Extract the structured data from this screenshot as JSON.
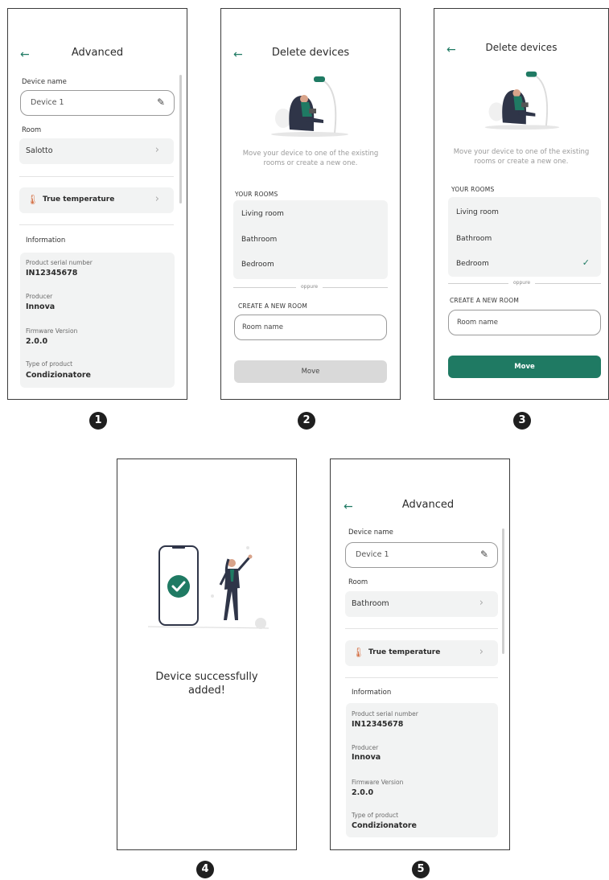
{
  "screens": {
    "s1": {
      "title": "Advanced",
      "device_name_label": "Device name",
      "device_name_value": "Device 1",
      "room_label": "Room",
      "room_value": "Salotto",
      "true_temperature": "True temperature",
      "information_label": "Information",
      "serial_label": "Product serial number",
      "serial_value": "IN12345678",
      "producer_label": "Producer",
      "producer_value": "Innova",
      "firmware_label": "Firmware Version",
      "firmware_value": "2.0.0",
      "type_label": "Type of product",
      "type_value": "Condizionatore",
      "step": "1"
    },
    "s2": {
      "title": "Delete devices",
      "description_line1": "Move your device to one of the existing",
      "description_line2": "rooms or create a new one.",
      "your_rooms": "YOUR ROOMS",
      "rooms": [
        "Living room",
        "Bathroom",
        "Bedroom"
      ],
      "or": "oppure",
      "create_new_room": "CREATE A NEW ROOM",
      "room_name_placeholder": "Room name",
      "move": "Move",
      "step": "2"
    },
    "s3": {
      "title": "Delete devices",
      "description_line1": "Move your device to one of the existing",
      "description_line2": "rooms or create a new one.",
      "your_rooms": "YOUR ROOMS",
      "rooms": [
        "Living room",
        "Bathroom",
        "Bedroom"
      ],
      "selected_room": "Bedroom",
      "or": "oppure",
      "create_new_room": "CREATE A NEW ROOM",
      "room_name_placeholder": "Room name",
      "move": "Move",
      "step": "3"
    },
    "s4": {
      "message_line1": "Device successfully",
      "message_line2": "added!",
      "step": "4"
    },
    "s5": {
      "title": "Advanced",
      "device_name_label": "Device name",
      "device_name_value": "Device 1",
      "room_label": "Room",
      "room_value": "Bathroom",
      "true_temperature": "True temperature",
      "information_label": "Information",
      "serial_label": "Product serial number",
      "serial_value": "IN12345678",
      "producer_label": "Producer",
      "producer_value": "Innova",
      "firmware_label": "Firmware Version",
      "firmware_value": "2.0.0",
      "type_label": "Type of product",
      "type_value": "Condizionatore",
      "step": "5"
    }
  },
  "icons": {
    "back": "arrow-left-icon",
    "edit": "pencil-icon",
    "chevron": "chevron-right-icon",
    "thermometer": "thermometer-icon",
    "check": "check-icon"
  },
  "colors": {
    "accent": "#1f7a63",
    "disabled_button": "#d9d9d9",
    "row_background": "#f2f3f3"
  }
}
